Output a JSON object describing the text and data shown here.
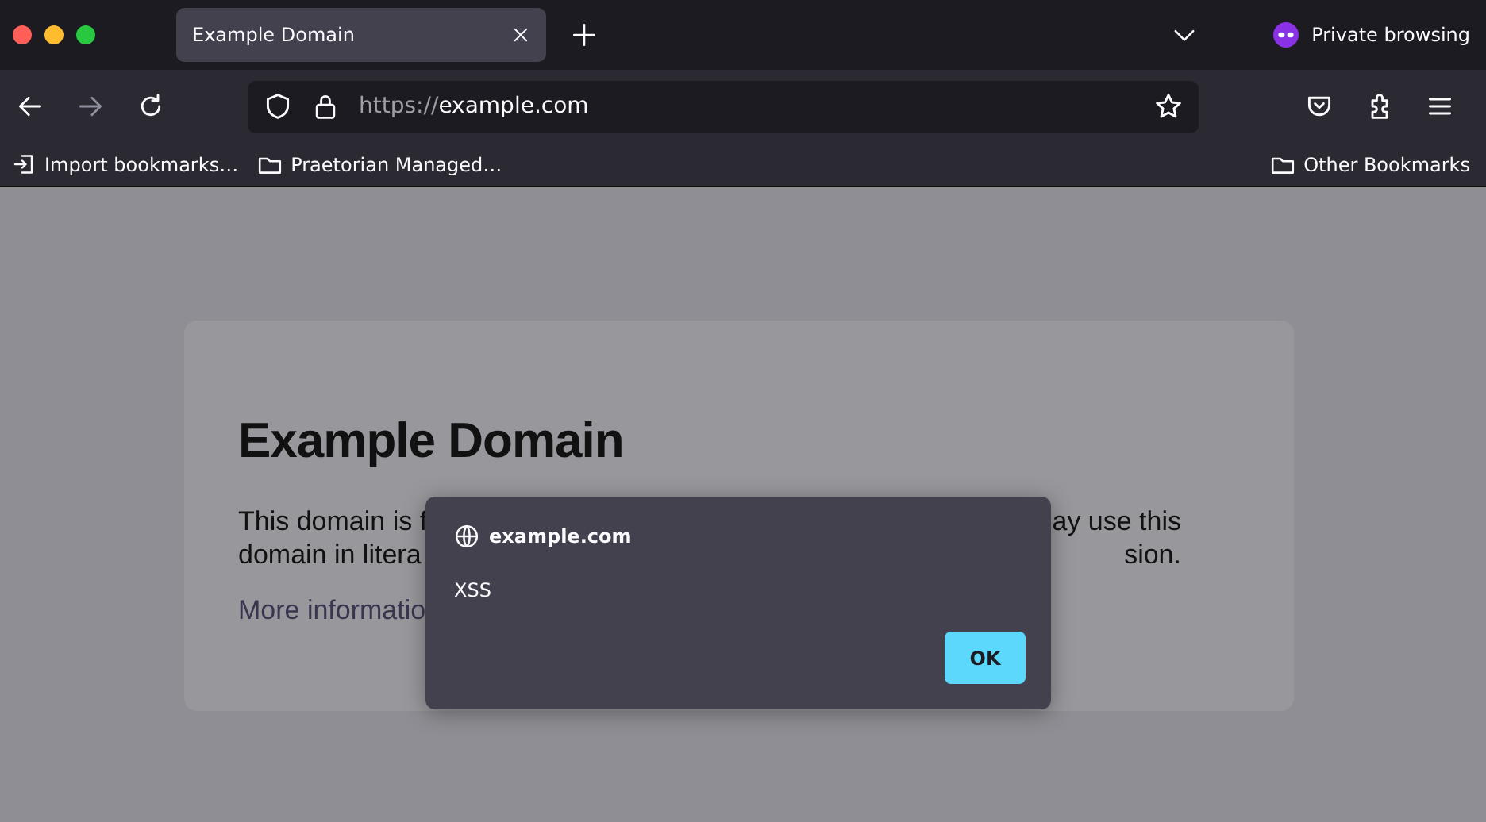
{
  "tabs": [
    {
      "title": "Example Domain",
      "selected": true
    }
  ],
  "private_label": "Private browsing",
  "address": {
    "scheme": "https://",
    "host": "example.com"
  },
  "bookmarks": [
    {
      "label": "Import bookmarks…",
      "kind": "import"
    },
    {
      "label": "Praetorian Managed…",
      "kind": "folder"
    }
  ],
  "other_bookmarks": "Other Bookmarks",
  "page": {
    "heading": "Example Domain",
    "lines": [
      {
        "left": "This domain is f",
        "right": "ay use this"
      },
      {
        "left": "domain in litera",
        "right": "sion."
      }
    ],
    "link": "More informatio"
  },
  "dialog": {
    "origin": "example.com",
    "message": "XSS",
    "button": "OK"
  }
}
